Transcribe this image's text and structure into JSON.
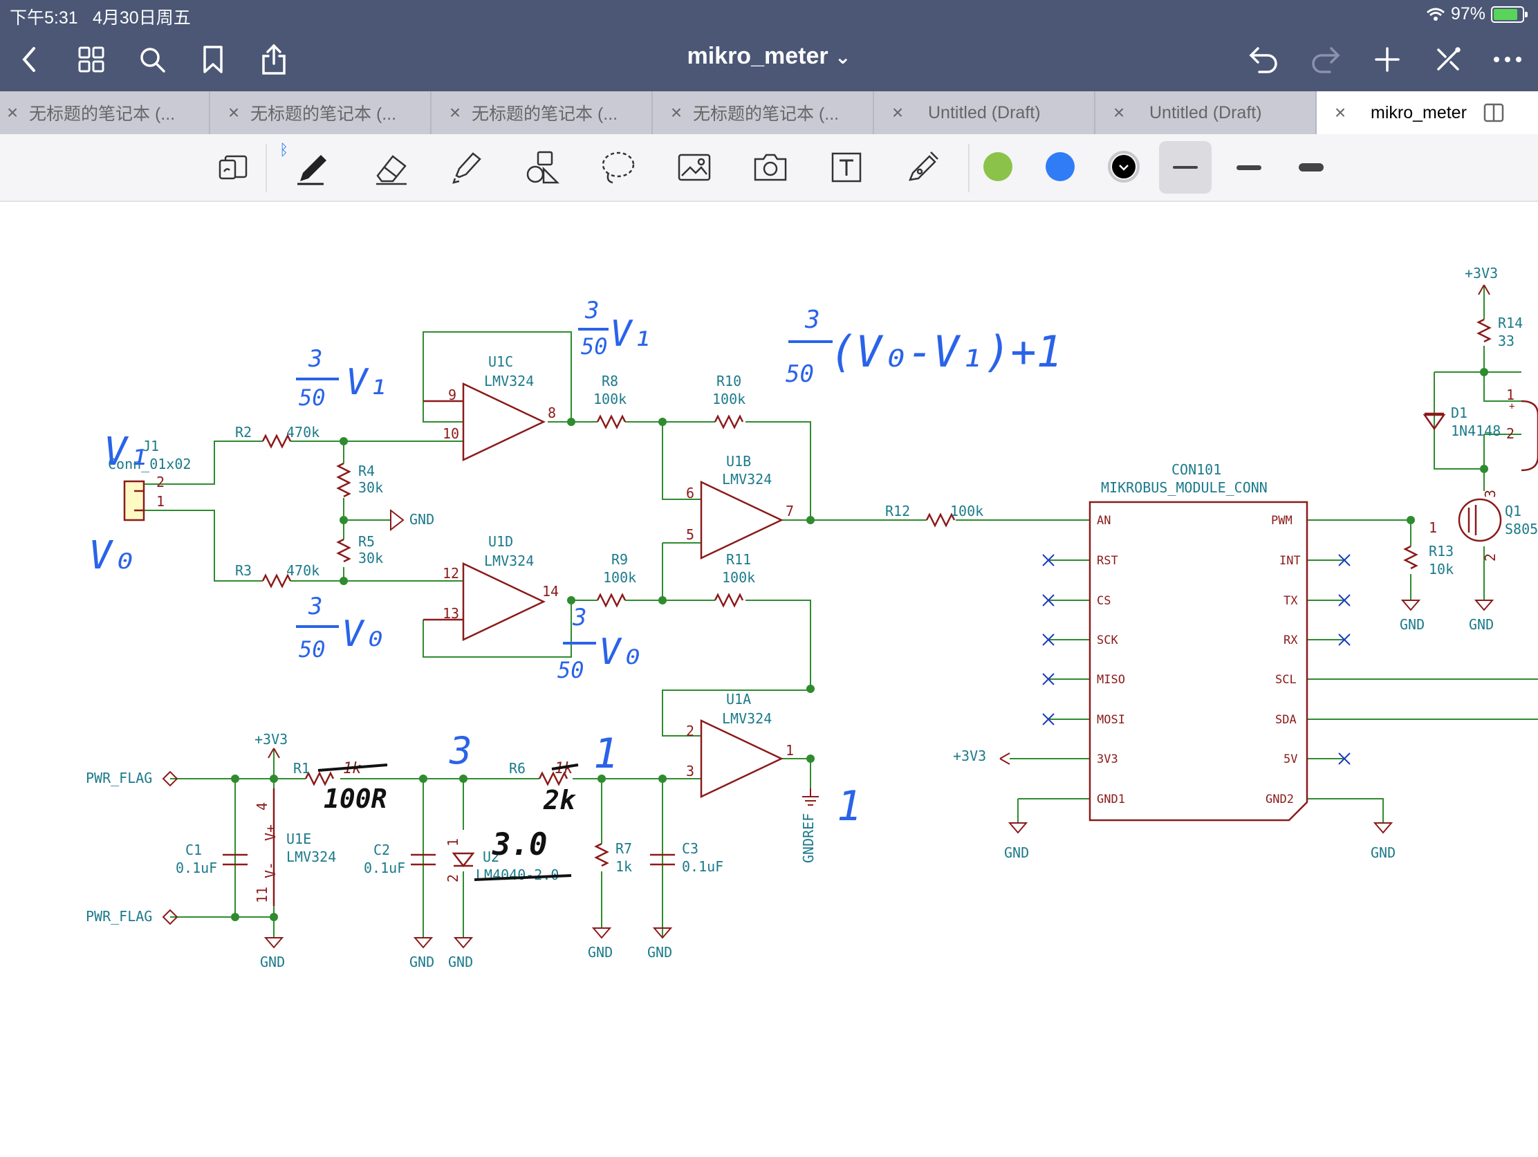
{
  "status": {
    "time": "下午5:31",
    "date": "4月30日周五",
    "battery": "97%"
  },
  "nav": {
    "title": "mikro_meter",
    "dropdown": "⌄"
  },
  "tabs": [
    {
      "label": "无标题的笔记本 (..."
    },
    {
      "label": "无标题的笔记本 (..."
    },
    {
      "label": "无标题的笔记本 (..."
    },
    {
      "label": "无标题的笔记本 (..."
    },
    {
      "label": "Untitled (Draft)"
    },
    {
      "label": "Untitled (Draft)"
    },
    {
      "label": "mikro_meter",
      "active": true
    }
  ],
  "tab_close": "×",
  "toolbar": {
    "colors": [
      "#8bc34a",
      "#2f7cf6",
      "#000000"
    ],
    "bluetooth_symbol": "ᛒ"
  },
  "schematic": {
    "connector": {
      "ref": "J1",
      "value": "Conn_01x02",
      "pin2": "2",
      "pin1": "1"
    },
    "r2": {
      "ref": "R2",
      "value": "470k"
    },
    "r3": {
      "ref": "R3",
      "value": "470k"
    },
    "r4": {
      "ref": "R4",
      "value": "30k"
    },
    "r5": {
      "ref": "R5",
      "value": "30k"
    },
    "r8": {
      "ref": "R8",
      "value": "100k"
    },
    "r9": {
      "ref": "R9",
      "value": "100k"
    },
    "r10": {
      "ref": "R10",
      "value": "100k"
    },
    "r11": {
      "ref": "R11",
      "value": "100k"
    },
    "r12": {
      "ref": "R12",
      "value": "100k"
    },
    "r13": {
      "ref": "R13",
      "value": "10k"
    },
    "r14": {
      "ref": "R14",
      "value": "33"
    },
    "r1": {
      "ref": "R1",
      "value": "1k"
    },
    "r6": {
      "ref": "R6",
      "value": "1k"
    },
    "r7": {
      "ref": "R7",
      "value": "1k"
    },
    "u1c": {
      "ref": "U1C",
      "value": "LMV324",
      "pin_minus": "9",
      "pin_plus": "10",
      "pin_out": "8"
    },
    "u1d": {
      "ref": "U1D",
      "value": "LMV324",
      "pin_plus": "12",
      "pin_minus": "13",
      "pin_out": "14"
    },
    "u1b": {
      "ref": "U1B",
      "value": "LMV324",
      "pin_minus": "6",
      "pin_plus": "5",
      "pin_out": "7"
    },
    "u1a": {
      "ref": "U1A",
      "value": "LMV324",
      "pin_minus": "2",
      "pin_plus": "3",
      "pin_out": "1"
    },
    "u1e": {
      "ref": "U1E",
      "value": "LMV324",
      "vplus": "V+",
      "vminus": "V-",
      "pin4": "4",
      "pin11": "11"
    },
    "c1": {
      "ref": "C1",
      "value": "0.1uF"
    },
    "c2": {
      "ref": "C2",
      "value": "0.1uF"
    },
    "c3": {
      "ref": "C3",
      "value": "0.1uF"
    },
    "u2": {
      "ref": "U2",
      "value": "LM4040-2.0",
      "pin1": "1",
      "pin2": "2"
    },
    "d1": {
      "ref": "D1",
      "value": "1N4148"
    },
    "q1": {
      "ref": "Q1",
      "value": "S805",
      "pin1": "1",
      "pin2": "2",
      "pin3": "3"
    },
    "pwr_flag": "PWR_FLAG",
    "gnd": "GND",
    "v33": "+3V3",
    "gndref": "GNDREF",
    "mikrobus": {
      "ref": "CON101",
      "value": "MIKROBUS_MODULE_CONN",
      "left_pins": [
        "AN",
        "RST",
        "CS",
        "SCK",
        "MISO",
        "MOSI",
        "3V3",
        "GND1"
      ],
      "right_pins": [
        "PWM",
        "INT",
        "TX",
        "RX",
        "SCL",
        "SDA",
        "5V",
        "GND2"
      ]
    },
    "misc_pins": {
      "p1": "1",
      "p2": "2",
      "plus": "+"
    }
  },
  "annotations": {
    "v1": "V₁",
    "v0": "V₀",
    "frac_num": "3",
    "frac_den": "50",
    "diff": "(V₀-V₁)+1",
    "r1_new": "100R",
    "r6_new": "2k",
    "u2_new": "3.0",
    "n3": "3",
    "n1": "1"
  }
}
